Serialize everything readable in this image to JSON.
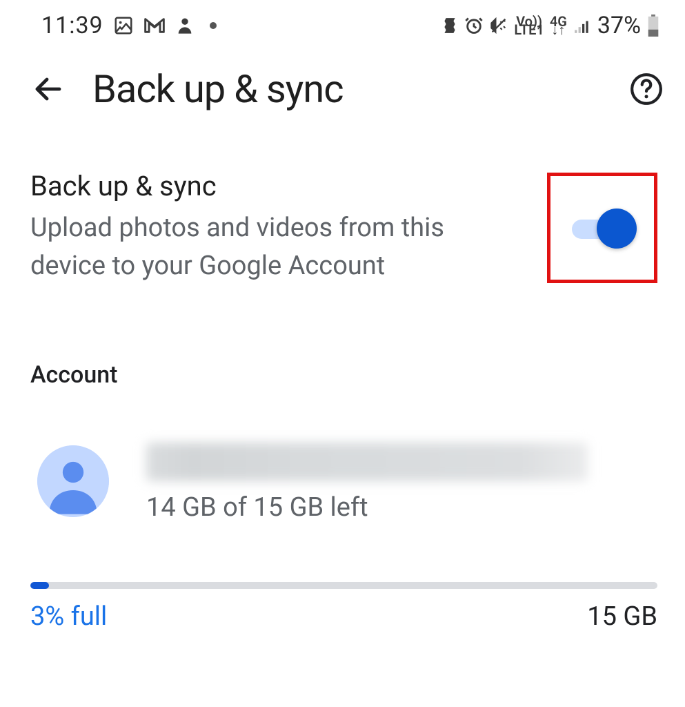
{
  "status_bar": {
    "time": "11:39",
    "battery_pct": "37%",
    "icons": {
      "image": "image-icon",
      "gmail": "gmail-icon",
      "person": "person-icon",
      "dot": "dot-icon",
      "play_update": "play-update-icon",
      "alarm": "alarm-icon",
      "vibrate": "vibrate-icon",
      "volte": "Vo))",
      "lte": "LTE1",
      "fourg": "4G",
      "arrows": "↓↑",
      "signal": "signal-icon",
      "battery_icon": "battery-icon"
    }
  },
  "header": {
    "title": "Back up & sync",
    "back_label": "Back",
    "help_label": "Help"
  },
  "backup_setting": {
    "title": "Back up & sync",
    "description": "Upload photos and videos from this device to your Google Account",
    "toggle_on": true
  },
  "account_section": {
    "label": "Account",
    "storage_text": "14 GB of 15 GB left"
  },
  "storage": {
    "percent_full_label": "3% full",
    "total_label": "15 GB",
    "percent_fill_css": "3%"
  }
}
